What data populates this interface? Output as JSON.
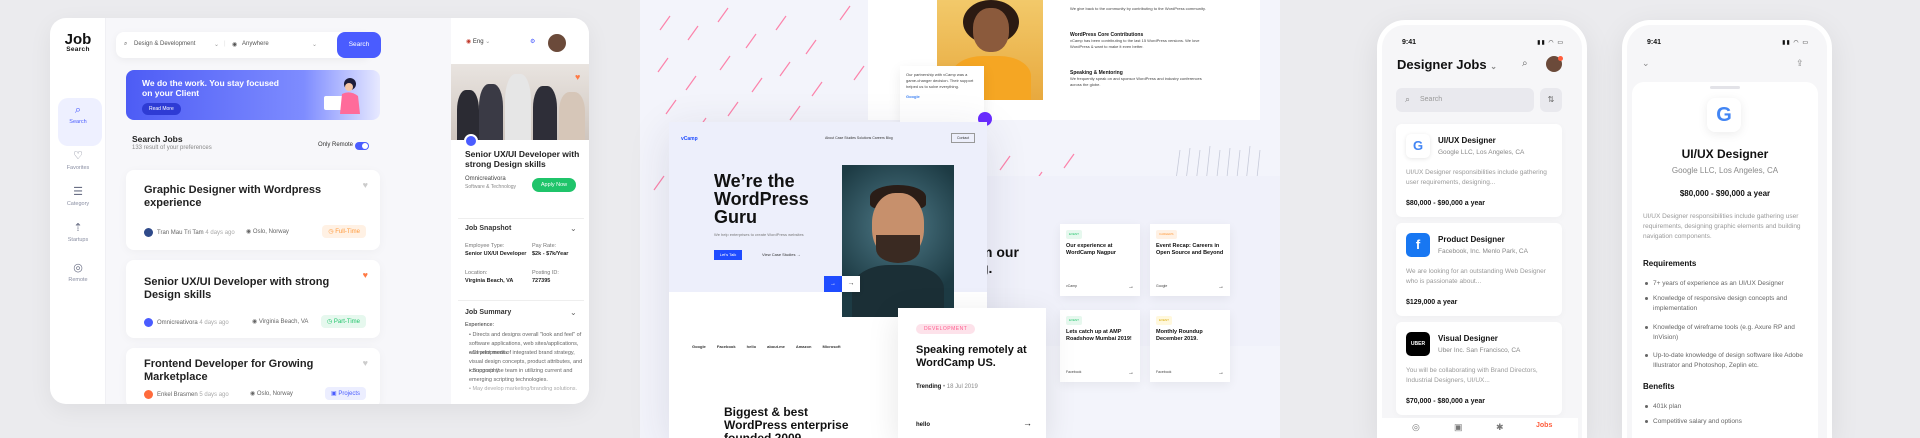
{
  "jobsearch": {
    "logo_line1": "Job",
    "logo_line2": "Search",
    "nav": [
      {
        "label": "Search"
      },
      {
        "label": "Favorites"
      },
      {
        "label": "Category"
      },
      {
        "label": "Startups"
      },
      {
        "label": "Remote"
      }
    ],
    "search": {
      "category": "Design & Development",
      "location": "Anywhere",
      "button": "Search"
    },
    "banner": {
      "text": "We do the work. You stay focused on your Client",
      "button": "Read More"
    },
    "list_title": "Search Jobs",
    "list_sub": "133 result of your preferences",
    "only_remote": "Only Remote",
    "jobs": [
      {
        "title": "Graphic Designer with Wordpress experience",
        "company": "Tran Mau Tri Tam",
        "time": "4 days ago",
        "location": "Oslo, Norway",
        "tag": "Full-Time",
        "tag_color": "#ff9a3c",
        "tag_bg": "#fff1e4"
      },
      {
        "title": "Senior UX/UI Developer with strong Design skills",
        "company": "Omnicreativora",
        "time": "4 days ago",
        "location": "Virginia Beach, VA",
        "tag": "Part-Time",
        "tag_color": "#1fc46a",
        "tag_bg": "#e6f8ee"
      },
      {
        "title": "Frontend Developer for Growing Marketplace",
        "company": "Enkel Brasmen",
        "time": "5 days ago",
        "location": "Oslo, Norway",
        "tag": "Projects",
        "tag_color": "#4a5cff",
        "tag_bg": "#eceeff"
      }
    ],
    "lang": "Eng",
    "detail": {
      "title": "Senior UX/UI Developer with strong Design skills",
      "company": "Omnicreativora",
      "category": "Software & Technology",
      "apply": "Apply Now",
      "snapshot": "Job Snapshot",
      "employee_type_label": "Employee Type:",
      "employee_type": "Senior UX/UI Developer",
      "pay_rate_label": "Pay Rate:",
      "pay_rate": "$2k - $7k/Year",
      "location_label": "Location:",
      "location": "Virginia Beach, VA",
      "posting_label": "Posting ID:",
      "posting": "727395",
      "summary": "Job Summary",
      "experience": "Experience:",
      "bullets": [
        "Directs and designs overall \"look and feel\" of software applications, web sites/applications, and print media.",
        "Development of integrated brand strategy, visual design concepts, product attributes, and iconography.",
        "Supports the team in utilizing current and emerging scripting technologies.",
        "May develop marketing/branding solutions."
      ]
    }
  },
  "wordcamp": {
    "logo": "vCamp",
    "nav": "About   Case Studies   Solutions   Careers   Blog",
    "contact": "Contact",
    "hero_title": "We’re the WordPress Guru",
    "hero_sub": "We help enterprises to create WordPress websites",
    "hero_btn": "Let’s Talk",
    "hero_btn2": "View Case Studies",
    "brands": "Google   Facebook   hello   about.me   Amazon   Microsoft",
    "quote": "Our partnership with vCamp was a game-changer decision. Their support helped us to solve everything.",
    "quote_src": "Google",
    "blurb1_title": "",
    "blurb1": "We give back to the community by contributing to the WordPress community.",
    "blurb2_title": "WordPress Core Contributions",
    "blurb2": "vCamp has been contributing to the last 15 WordPress versions. We love WordPress & want to make it even better.",
    "blurb3_title": "Speaking & Mentoring",
    "blurb3": "We frequently speak on and sponsor WordPress and industry conferences across the globe.",
    "omur": "m our\ng.",
    "cards": [
      {
        "badge": "EVENT",
        "title": "Our experience at WordCamp Nagpur",
        "foot": "vCamp",
        "color": "#1fc46a"
      },
      {
        "badge": "CAREERS",
        "title": "Event Recap: Careers in Open Source and Beyond",
        "foot": "Google",
        "color": "#ff9a3c"
      },
      {
        "badge": "EVENT",
        "title": "Lets catch up at AMP Roadshow Mumbai 2019!",
        "foot": "Facebook",
        "color": "#1fc46a"
      },
      {
        "badge": "EVENT",
        "title": "Monthly Roundup December 2019.",
        "foot": "Facebook",
        "color": "#ffc928"
      }
    ],
    "speak_badge": "DEVELOPMENT",
    "speak_title": "Speaking remotely at WordCamp US.",
    "speak_trend": "Trending",
    "speak_date": "• 18 Jul 2019",
    "speak_foot": "hello",
    "biggest": "Biggest & best WordPress enterprise founded 2009"
  },
  "mobile": {
    "time": "9:41",
    "title": "Designer Jobs",
    "search_placeholder": "Search",
    "jobs": [
      {
        "logo": "G",
        "logo_color": "#4285f4",
        "logo_bg": "#fff",
        "title": "UI/UX Designer",
        "company": "Google LLC, Los Angeles, CA",
        "desc": "UI/UX Designer responsibilities include gathering user requirements, designing...",
        "salary": "$80,000 - $90,000 a year"
      },
      {
        "logo": "f",
        "logo_color": "#fff",
        "logo_bg": "#1877f2",
        "title": "Product Designer",
        "company": "Facebook, Inc. Menlo Park, CA",
        "desc": "We are looking for an outstanding Web Designer who is passionate about...",
        "salary": "$129,000 a year"
      },
      {
        "logo": "UBER",
        "logo_color": "#fff",
        "logo_bg": "#000",
        "title": "Visual Designer",
        "company": "Uber Inc. San Francisco, CA",
        "desc": "You will be collaborating with Brand Directors, Industrial Designers, UI/UX...",
        "salary": "$70,000 - $80,000 a year"
      }
    ],
    "active_tab": "Jobs",
    "detail": {
      "logo": "G",
      "title": "UI/UX Designer",
      "company": "Google LLC, Los Angeles, CA",
      "salary": "$80,000 - $90,000 a year",
      "desc": "UI/UX Designer responsibilities include gathering user requirements, designing graphic elements and building navigation components.",
      "req_title": "Requirements",
      "requirements": [
        "7+ years of experience as an UI/UX Designer",
        "Knowledge of responsive design concepts and implementation",
        "Knowledge of wireframe tools (e.g. Axure RP and InVision)",
        "Up-to-date knowledge of design software like Adobe Illustrator and Photoshop, Zeplin etc."
      ],
      "ben_title": "Benefits",
      "benefits": [
        "401k plan",
        "Competitive salary and options"
      ]
    }
  }
}
